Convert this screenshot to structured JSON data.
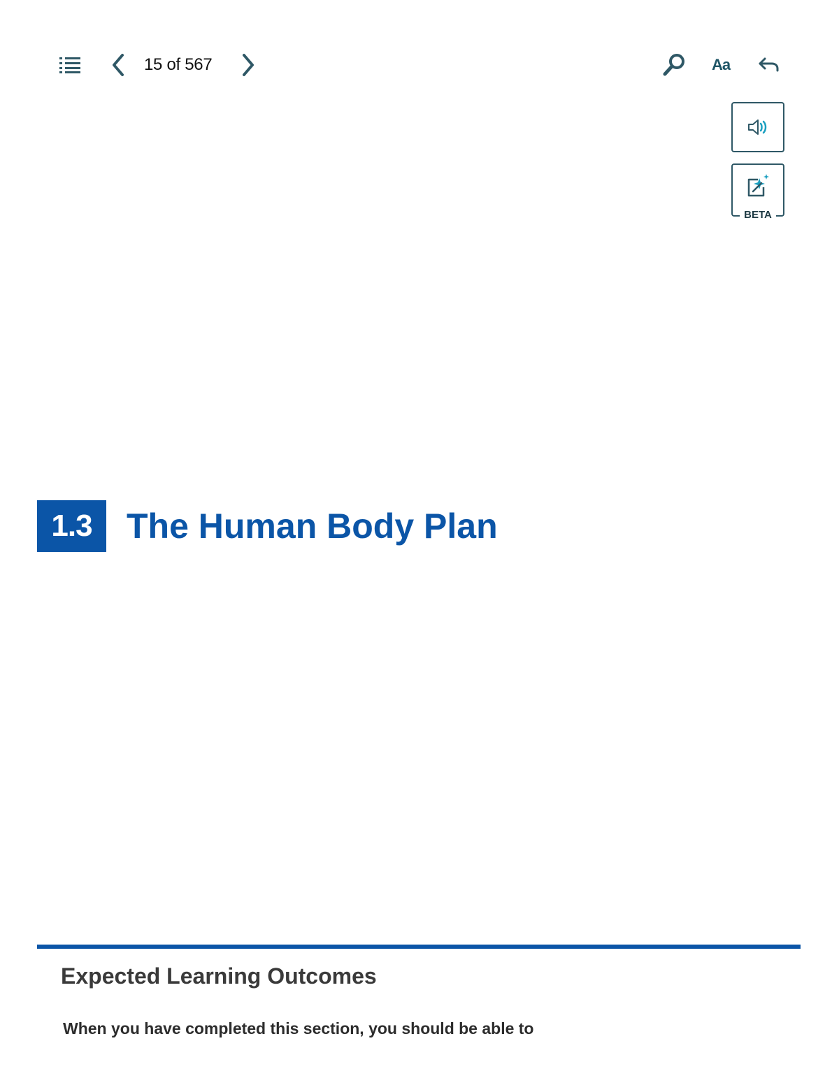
{
  "toolbar": {
    "toc_icon": "list-icon",
    "prev_icon": "chevron-left-icon",
    "page_counter": "15 of 567",
    "next_icon": "chevron-right-icon",
    "search_icon": "search-icon",
    "font_label": "Aa",
    "back_icon": "undo-arrow-icon",
    "icon_color": "#2f5866"
  },
  "side_tools": {
    "audio_icon": "speaker-icon",
    "ai_icon": "ai-sparkle-edit-icon",
    "ai_badge": "BETA",
    "accent_color": "#1a9fc0"
  },
  "section": {
    "number": "1.3",
    "title": "The Human Body Plan",
    "color": "#0b55a7"
  },
  "outcomes": {
    "heading": "Expected Learning Outcomes",
    "intro": "When you have completed this section, you should be able to"
  }
}
